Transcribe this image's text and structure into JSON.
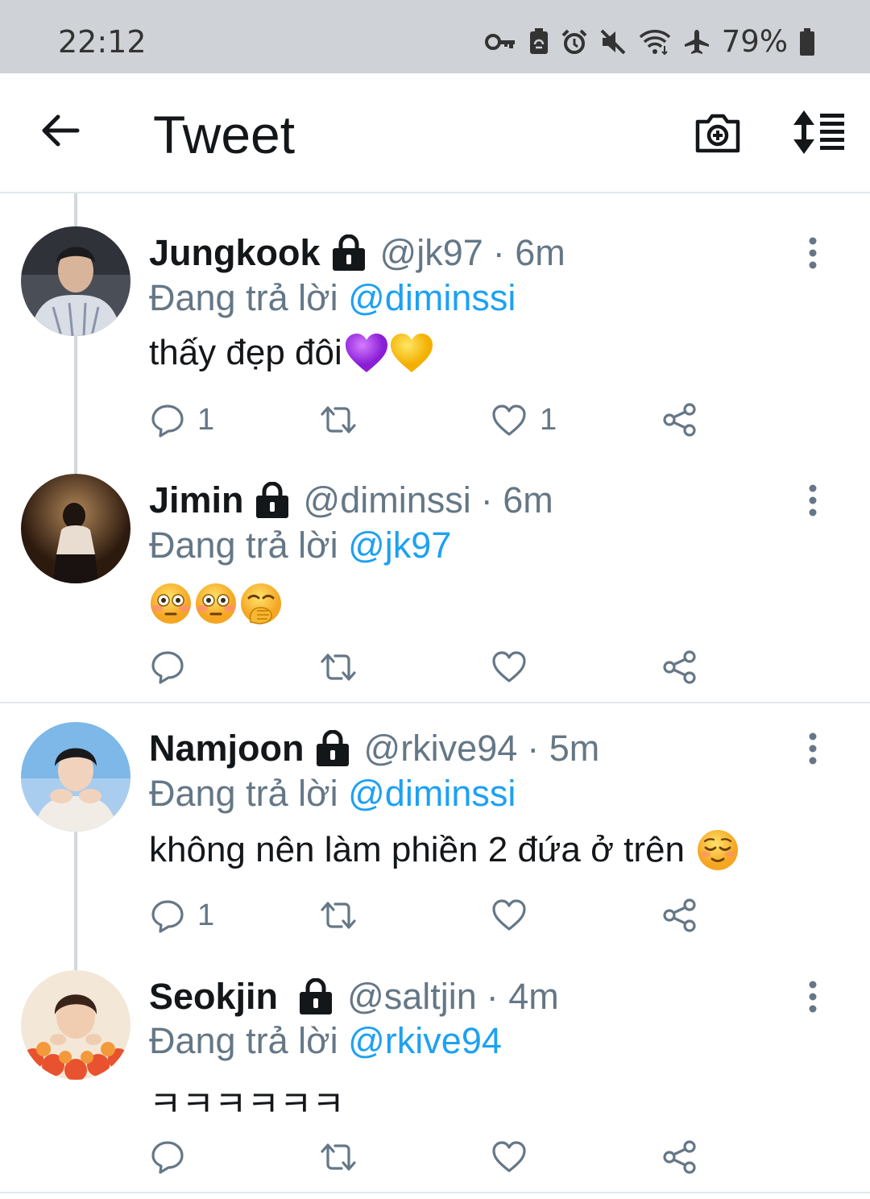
{
  "status_bar": {
    "time": "22:12",
    "battery": "79%",
    "icons": [
      "vpn-key-icon",
      "storage-icon",
      "alarm-icon",
      "mute-icon",
      "wifi-icon",
      "airplane-icon",
      "battery-icon"
    ]
  },
  "header": {
    "title": "Tweet",
    "icons": [
      "back-arrow-icon",
      "camera-add-icon",
      "sort-icon"
    ]
  },
  "reply_prefix": "Đang trả lời",
  "tweets": [
    {
      "name": "Jungkook",
      "handle": "@jk97",
      "time": "· 6m",
      "reply_to": "@diminssi",
      "text": "thấy đẹp đôi",
      "emojis": [
        "purple-heart",
        "yellow-heart"
      ],
      "replies": "1",
      "retweets": "",
      "likes": "1"
    },
    {
      "name": "Jimin",
      "handle": "@diminssi",
      "time": "· 6m",
      "reply_to": "@jk97",
      "text": "",
      "emojis": [
        "flushed-face",
        "flushed-face",
        "face-with-hand-over-mouth"
      ],
      "replies": "",
      "retweets": "",
      "likes": ""
    },
    {
      "name": "Namjoon",
      "handle": "@rkive94",
      "time": "· 5m",
      "reply_to": "@diminssi",
      "text": "không nên làm phiền 2 đứa ở trên",
      "emojis": [
        "relieved-face"
      ],
      "replies": "1",
      "retweets": "",
      "likes": ""
    },
    {
      "name": "Seokjin",
      "handle": "@saltjin",
      "time": "· 4m",
      "reply_to": "@rkive94",
      "text": "ㅋㅋㅋㅋㅋㅋ",
      "emojis": [],
      "replies": "",
      "retweets": "",
      "likes": ""
    }
  ],
  "colors": {
    "accent": "#1da1f2",
    "secondary_text": "#657786",
    "status_bar": "#cfd2d6"
  }
}
